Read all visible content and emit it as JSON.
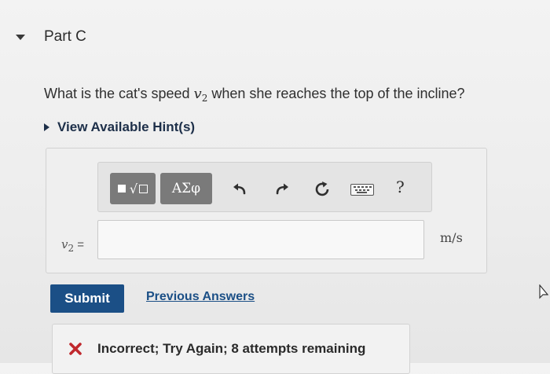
{
  "part": {
    "title": "Part C"
  },
  "question": {
    "before": "What is the cat's speed ",
    "var_symbol": "v",
    "var_subscript": "2",
    "after": " when she reaches the top of the incline?"
  },
  "hint": {
    "label": "View Available Hint(s)"
  },
  "toolbar": {
    "math_button_symbol": "√",
    "greek_button_label": "ΑΣφ",
    "help_label": "?",
    "icons": [
      "templates-icon",
      "greek-symbols-icon",
      "undo-icon",
      "redo-icon",
      "reset-icon",
      "keyboard-icon",
      "help-icon"
    ]
  },
  "answer": {
    "label_symbol": "v",
    "label_subscript": "2",
    "label_equals": "=",
    "value": "",
    "unit": "m/s"
  },
  "actions": {
    "submit_label": "Submit",
    "previous_answers_label": "Previous Answers"
  },
  "feedback": {
    "text": "Incorrect; Try Again; 8 attempts remaining",
    "status_color": "#c0282d"
  },
  "colors": {
    "primary": "#1b4f86",
    "toolbar_button": "#7a7a7a",
    "hint_link": "#1d2f49"
  }
}
